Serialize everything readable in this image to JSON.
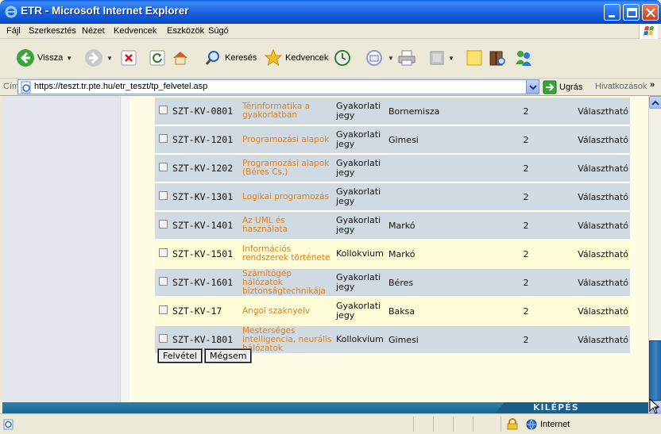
{
  "window": {
    "title": "ETR - Microsoft Internet Explorer"
  },
  "menu": [
    "Fájl",
    "Szerkesztés",
    "Nézet",
    "Kedvencek",
    "Eszközök",
    "Súgó"
  ],
  "toolbar": {
    "back": "Vissza",
    "search": "Keresés",
    "favorites": "Kedvencek"
  },
  "address": {
    "label": "Cím",
    "url": "https://teszt.tr.pte.hu/etr_teszt/tp_felvetel.asp",
    "go": "Ugrás",
    "links": "Hivatkozások",
    "chevron": "»"
  },
  "courses": [
    {
      "code": "SZT-KV-0801",
      "name": "Térinformatika a gyakorlatban",
      "type": "Gyakorlati jegy",
      "teacher": "Bornemisza",
      "credit": "2",
      "status": "Választható"
    },
    {
      "code": "SZT-KV-1201",
      "name": "Programozási alapok",
      "type": "Gyakorlati jegy",
      "teacher": "Gimesi",
      "credit": "2",
      "status": "Választható"
    },
    {
      "code": "SZT-KV-1202",
      "name": "Programozási alapok (Béres Cs.)",
      "type": "Gyakorlati jegy",
      "teacher": "",
      "credit": "2",
      "status": "Választható"
    },
    {
      "code": "SZT-KV-1301",
      "name": "Logikai programozás",
      "type": "Gyakorlati jegy",
      "teacher": "",
      "credit": "2",
      "status": "Választható"
    },
    {
      "code": "SZT-KV-1401",
      "name": "Az UML és használata",
      "type": "Gyakorlati jegy",
      "teacher": "Markó",
      "credit": "2",
      "status": "Választható"
    },
    {
      "code": "SZT-KV-1501",
      "name": "Információs rendszerek története",
      "type": "Kollokvium",
      "teacher": "Markó",
      "credit": "2",
      "status": "Választható"
    },
    {
      "code": "SZT-KV-1601",
      "name": "Számítógép hálózatok biztonságtechnikája",
      "type": "Gyakorlati jegy",
      "teacher": "Béres",
      "credit": "2",
      "status": "Választható"
    },
    {
      "code": "SZT-KV-17",
      "name": "Angol szaknyelv",
      "type": "Gyakorlati jegy",
      "teacher": "Baksa",
      "credit": "2",
      "status": "Választható"
    },
    {
      "code": "SZT-KV-1801",
      "name": "Mesterséges intelligencia, neurális hálózatok",
      "type": "Kollokvium",
      "teacher": "Gimesi",
      "credit": "2",
      "status": "Választható"
    }
  ],
  "buttons": {
    "submit": "Felvétel",
    "cancel": "Mégsem"
  },
  "footer": {
    "exit": "KILÉPÉS"
  },
  "status": {
    "zone": "Internet"
  },
  "colors": {
    "titlebar": "#0a5fe0",
    "course_name": "#e2811d",
    "row_blue": "#cfdae2",
    "row_cream": "#fefcd6",
    "footer_bar": "#2b7fa7"
  }
}
